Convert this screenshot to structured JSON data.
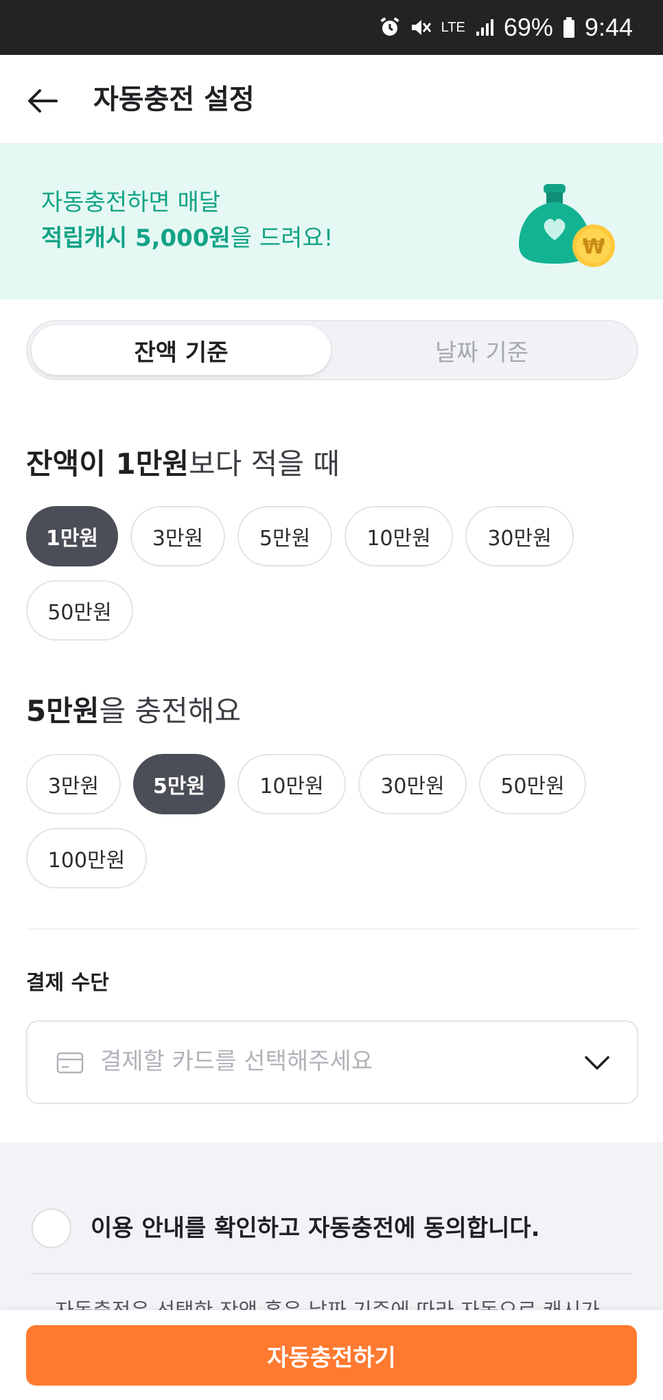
{
  "status_bar": {
    "battery": "69%",
    "time": "9:44",
    "network": "LTE"
  },
  "header": {
    "title": "자동충전 설정"
  },
  "banner": {
    "line1": "자동충전하면 매달",
    "line2_bold": "적립캐시 5,000원",
    "line2_rest": "을 드려요!"
  },
  "tabs": [
    {
      "label": "잔액 기준",
      "active": true
    },
    {
      "label": "날짜 기준",
      "active": false
    }
  ],
  "threshold": {
    "title_bold": "잔액이 1만원",
    "title_rest": "보다 적을 때",
    "options": [
      "1만원",
      "3만원",
      "5만원",
      "10만원",
      "30만원",
      "50만원"
    ],
    "selected": "1만원"
  },
  "charge_amount": {
    "title_bold": "5만원",
    "title_rest": "을 충전해요",
    "options": [
      "3만원",
      "5만원",
      "10만원",
      "30만원",
      "50만원",
      "100만원"
    ],
    "selected": "5만원"
  },
  "payment": {
    "label": "결제 수단",
    "placeholder": "결제할 카드를 선택해주세요"
  },
  "agreement": {
    "label": "이용 안내를 확인하고 자동충전에 동의합니다.",
    "info": "자동충전은 선택한 잔액 혹은 날짜 기준에 따라 자동으로 캐시가"
  },
  "cta": {
    "label": "자동충전하기"
  },
  "colors": {
    "accent": "#ff7a30",
    "banner_bg": "#e5f8f4",
    "banner_text": "#12a386",
    "chip_selected": "#4b4e57"
  }
}
